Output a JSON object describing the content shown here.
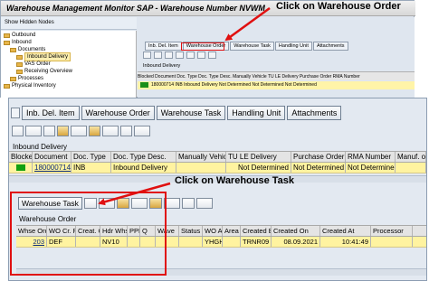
{
  "top_window": {
    "title": "Warehouse Management Monitor SAP - Warehouse Number NVWM",
    "toolbar_label": "Show Hidden Nodes",
    "tree": [
      {
        "label": "Outbound"
      },
      {
        "label": "Inbound"
      },
      {
        "label": "Documents"
      },
      {
        "label": "Inbound Delivery",
        "selected": true
      },
      {
        "label": "VAS Order"
      },
      {
        "label": "Receiving Overview"
      },
      {
        "label": "Processes"
      },
      {
        "label": "Physical Inventory"
      }
    ],
    "tabs": [
      "Inb. Del. Item",
      "Warehouse Order",
      "Warehouse Task",
      "Handling Unit",
      "Attachments"
    ],
    "section": "Inbound Delivery",
    "headers": "Blocked  Document  Doc. Type  Doc. Type Desc.  Manually Vehicle  TU LE Delivery  Purchase Order  RMA Number",
    "row": "180000714   INB   Inbound Delivery   Not Determined   Not Determined   Not Determined"
  },
  "main": {
    "tabs": [
      "Inb. Del. Item",
      "Warehouse Order",
      "Warehouse Task",
      "Handling Unit",
      "Attachments"
    ],
    "section": "Inbound Delivery",
    "columns": [
      "Blocked",
      "Document",
      "Doc. Type",
      "Doc. Type Desc.",
      "Manually Vehicle",
      "TU LE Delivery",
      "Purchase Order",
      "RMA Number",
      "Manuf. or"
    ],
    "row": {
      "document": "180000714",
      "doc_type": "INB",
      "doc_type_desc": "Inbound Delivery",
      "tu_le": "Not Determined",
      "purchase_order": "Not Determined",
      "rma_number": "Not Determined"
    }
  },
  "lower": {
    "tab": "Warehouse Task",
    "section": "Warehouse Order",
    "columns": [
      "Whse Order",
      "WO Cr. Rle",
      "Creat. Cat",
      "Hdr Whse",
      "PPF",
      "Q",
      "Wave",
      "Status",
      "WO Act",
      "Area",
      "Created By",
      "Created On",
      "Created At",
      "Processor"
    ],
    "row": {
      "whse_order": "203",
      "wo_cr_rle": "DEF",
      "hdr_whse": "NV10",
      "wo_act": "YHGH",
      "created_by": "TRNR09",
      "created_on": "08.09.2021",
      "created_at": "10:41:49"
    }
  },
  "callouts": {
    "warehouse_order": "Click on Warehouse Order",
    "warehouse_task": "Click on Warehouse Task"
  },
  "colors": {
    "annotation": "#e01010",
    "selected_row": "#fff3a0",
    "status_green": "#11a011"
  }
}
